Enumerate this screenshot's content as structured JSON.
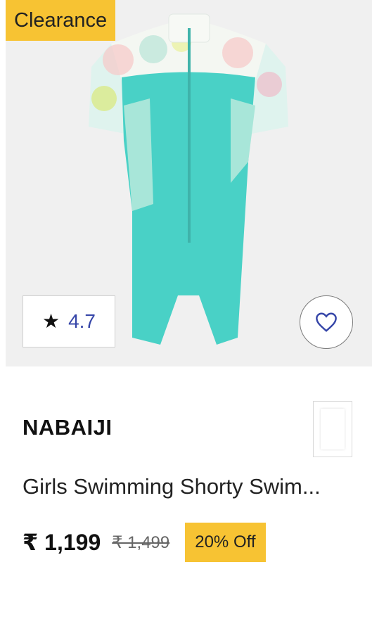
{
  "badge": {
    "label": "Clearance",
    "color": "#f7c333"
  },
  "rating": {
    "icon": "star-icon",
    "value": "4.7"
  },
  "wishlist": {
    "icon": "heart-icon"
  },
  "product": {
    "brand": "NABAIJI",
    "title": "Girls Swimming Shorty Swim...",
    "price": "₹ 1,199",
    "mrp": "₹ 1,499",
    "discount": "20% Off"
  },
  "colors": {
    "accent": "#f7c333",
    "rating_text": "#3545a8",
    "swimsuit": "#49d1c6"
  }
}
